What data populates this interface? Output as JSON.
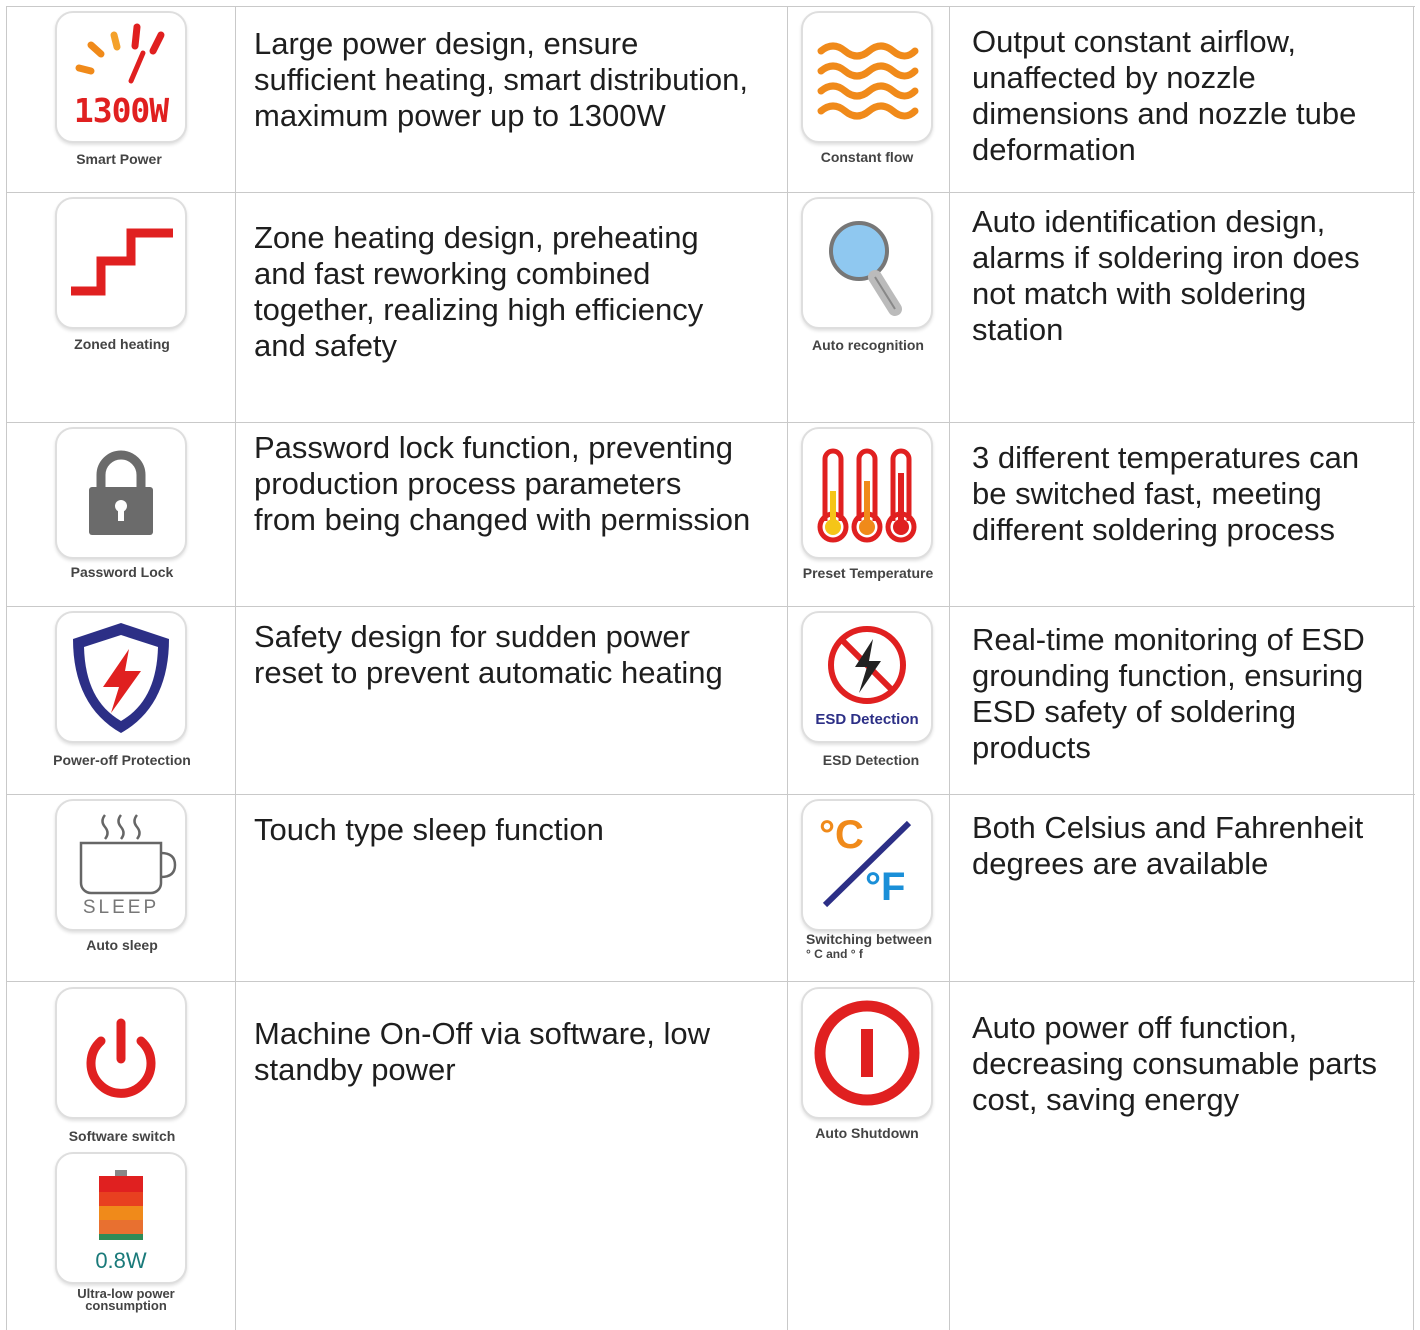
{
  "colors": {
    "red": "#e02020",
    "orange": "#f08a1a",
    "navy": "#2c2f86",
    "blue_light": "#8fc8f0",
    "gray_lock": "#6b6b6b",
    "grid": "#c9c9c9"
  },
  "features": [
    {
      "icon": "power-gauge-icon",
      "label": "1300W",
      "caption": "Smart Power",
      "text": [
        "Large power design, ensure",
        "sufficient heating, smart distribution,",
        "maximum power up to 1300W"
      ]
    },
    {
      "icon": "constant-flow-icon",
      "caption": "Constant flow",
      "text": [
        "Output constant airflow,",
        "unaffected by nozzle",
        "dimensions and nozzle tube",
        "deformation"
      ]
    },
    {
      "icon": "zoned-heating-icon",
      "caption": "Zoned heating",
      "text": [
        "Zone heating design, preheating",
        "and fast reworking combined",
        "together, realizing high efficiency",
        "and safety"
      ]
    },
    {
      "icon": "magnifier-icon",
      "caption": "Auto recognition",
      "text": [
        "Auto identification design,",
        "alarms if soldering iron does",
        "not match with soldering",
        "station"
      ]
    },
    {
      "icon": "lock-icon",
      "caption": "Password Lock",
      "text": [
        "Password lock function, preventing",
        "production process parameters",
        "from being changed with permission"
      ]
    },
    {
      "icon": "thermometer-icon",
      "caption": "Preset Temperature",
      "text": [
        "3 different temperatures can",
        "be switched fast, meeting",
        "different soldering process"
      ]
    },
    {
      "icon": "shield-bolt-icon",
      "caption": "Power-off Protection",
      "text": [
        "Safety design for sudden power",
        "reset to prevent automatic heating"
      ]
    },
    {
      "icon": "esd-icon",
      "label": "ESD Detection",
      "caption": "ESD Detection",
      "text": [
        "Real-time monitoring of ESD",
        "grounding function, ensuring",
        "ESD safety of soldering",
        "products"
      ]
    },
    {
      "icon": "sleep-cup-icon",
      "label": "SLEEP",
      "caption": "Auto sleep",
      "text": [
        "Touch type sleep function"
      ]
    },
    {
      "icon": "celsius-fahrenheit-icon",
      "label_c": "°C",
      "label_f": "°F",
      "caption": [
        "Switching between",
        "° C and ° f"
      ],
      "text": [
        "Both Celsius and Fahrenheit",
        "degrees are available"
      ]
    },
    {
      "icon": "power-button-icon",
      "caption": "Software switch",
      "text": [
        "Machine On-Off via software, low",
        "standby power"
      ]
    },
    {
      "icon": "shutdown-icon",
      "caption": "Auto Shutdown",
      "text": [
        "Auto power off function,",
        "decreasing consumable parts",
        "cost, saving energy"
      ]
    },
    {
      "icon": "battery-icon",
      "label": "0.8W",
      "caption": [
        "Ultra-low power",
        "consumption"
      ]
    }
  ]
}
